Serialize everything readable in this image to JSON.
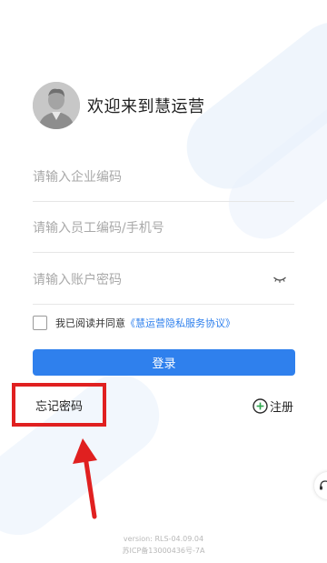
{
  "header": {
    "welcome": "欢迎来到慧运营"
  },
  "form": {
    "enterprise_placeholder": "请输入企业编码",
    "employee_placeholder": "请输入员工编码/手机号",
    "password_placeholder": "请输入账户密码"
  },
  "agreement": {
    "checked": false,
    "text": "我已阅读并同意",
    "link": "《慧运营隐私服务协议》"
  },
  "login_label": "登录",
  "forgot_label": "忘记密码",
  "register_label": "注册",
  "footer": {
    "version": "version: RLS-04.09.04",
    "icp": "苏ICP备13000436号-7A"
  },
  "icons": [
    "avatar",
    "eye-closed-icon",
    "plus-circle-icon",
    "red-arrow",
    "support-icon"
  ],
  "colors": {
    "primary": "#2f80ed",
    "highlight": "#e02020"
  }
}
